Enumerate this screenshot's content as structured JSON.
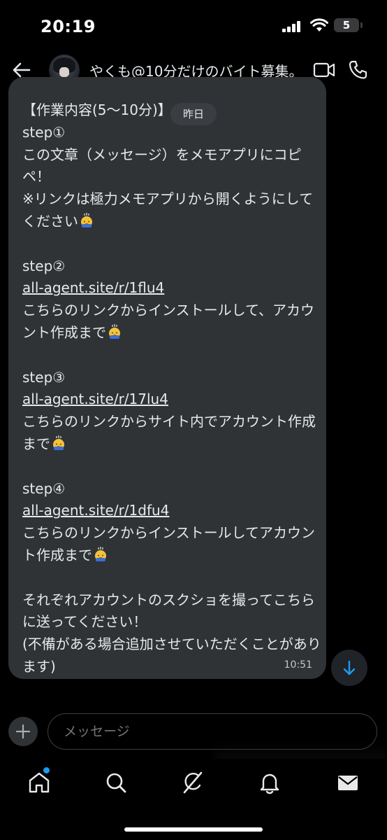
{
  "status_bar": {
    "time": "20:19",
    "battery": "5"
  },
  "header": {
    "title": "やくも@10分だけのバイト募集。"
  },
  "message": {
    "date_label": "昨日",
    "header_line": "【作業内容(5〜10分)】",
    "step1_title": "step①",
    "step1_text": "この文章（メッセージ）をメモアプリにコピペ！\n※リンクは極力メモアプリから開くようにしてください",
    "step2_title": "step②",
    "step2_link": "all-agent.site/r/1flu4",
    "step2_text": "こちらのリンクからインストールして、アカウント作成まで",
    "step3_title": "step③",
    "step3_link": "all-agent.site/r/17lu4",
    "step3_text": "こちらのリンクからサイト内でアカウント作成まで",
    "step4_title": "step④",
    "step4_link": "all-agent.site/r/1dfu4",
    "step4_text": "こちらのリンクからインストールしてアカウント作成まで",
    "closing_text": "それぞれアカウントのスクショを撮ってこちらに送ってください！\n(不備がある場合追加させていただくことがあります)",
    "time": "10:51"
  },
  "composer": {
    "placeholder": "メッセージ"
  },
  "nav": {
    "items": [
      "home-icon",
      "search-icon",
      "grok-icon",
      "notifications-icon",
      "messages-icon"
    ]
  },
  "colors": {
    "accent": "#1d9bf0",
    "bubble": "#2f3336",
    "background": "#000000"
  }
}
